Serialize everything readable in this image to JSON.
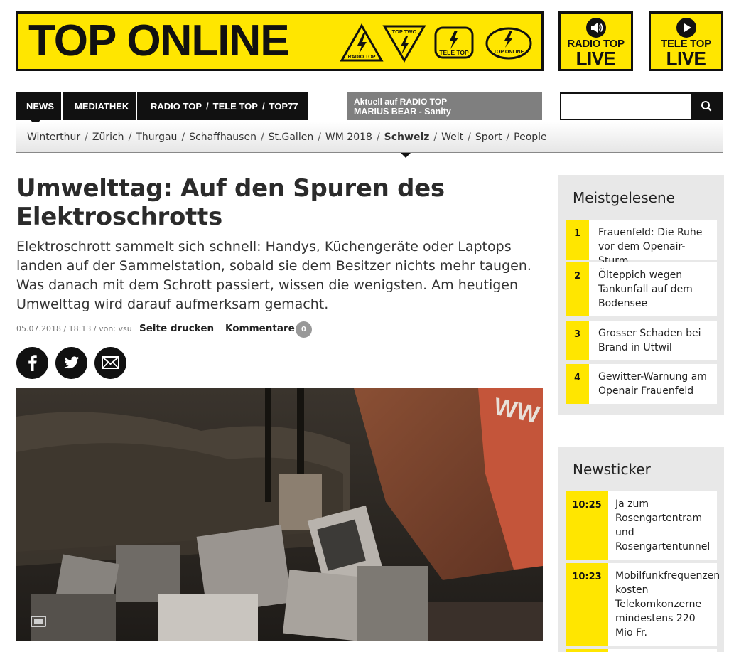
{
  "header": {
    "brand_title": "TOP ONLINE",
    "logos": [
      {
        "name": "radio-top-logo",
        "text": "RADIO TOP"
      },
      {
        "name": "top-two-logo",
        "text": "TOP TWO"
      },
      {
        "name": "tele-top-logo",
        "text": "TELE TOP"
      },
      {
        "name": "top-online-logo",
        "text": "TOP ONLINE"
      }
    ],
    "radio_live": {
      "line1": "RADIO TOP",
      "line2": "LIVE",
      "icon": "speaker-icon"
    },
    "tele_live": {
      "line1": "TELE TOP",
      "line2": "LIVE",
      "icon": "play-icon"
    }
  },
  "nav": {
    "news": "NEWS",
    "mediathek": "MEDIATHEK",
    "radio_top": "RADIO TOP",
    "tele_top": "TELE TOP",
    "top77": "TOP77",
    "separator": "/",
    "now_playing_title": "Aktuell auf RADIO TOP",
    "now_playing_track": "MARIUS BEAR - Sanity",
    "search_placeholder": "",
    "search_icon": "search-icon"
  },
  "subnav": {
    "items": [
      "Winterthur",
      "Zürich",
      "Thurgau",
      "Schaffhausen",
      "St.Gallen",
      "WM 2018",
      "Schweiz",
      "Welt",
      "Sport",
      "People"
    ],
    "active": "Schweiz"
  },
  "article": {
    "headline": "Umwelttag: Auf den Spuren des Elektroschrotts",
    "lead": "Elektroschrott sammelt sich schnell: Handys, Küchengeräte oder Laptops landen auf der Sammelstation, sobald sie dem Besitzer nichts mehr taugen. Was danach mit dem Schrott passiert, wissen die wenigsten. Am heutigen Umwelttag wird darauf aufmerksam gemacht.",
    "meta": "05.07.2018 / 18:13 / von: vsu",
    "print_label": "Seite drucken",
    "comments_label": "Kommentare",
    "comments_count": "0",
    "share_icons": [
      "facebook-icon",
      "twitter-icon",
      "email-icon"
    ]
  },
  "sidebar": {
    "most_read_title": "Meistgelesene",
    "most_read": [
      {
        "num": "1",
        "text": "Frauenfeld: Die Ruhe vor dem Openair-Sturm"
      },
      {
        "num": "2",
        "text": "Ölteppich wegen Tankunfall auf dem Bodensee"
      },
      {
        "num": "3",
        "text": "Grosser Schaden bei Brand in Uttwil"
      },
      {
        "num": "4",
        "text": "Gewitter-Warnung am Openair Frauenfeld"
      }
    ],
    "ticker_title": "Newsticker",
    "ticker": [
      {
        "time": "10:25",
        "text": "Ja zum Rosengartentram und Rosengartentunnel"
      },
      {
        "time": "10:23",
        "text": "Mobilfunkfrequenzen kosten Telekomkonzerne mindestens 220 Mio Fr."
      }
    ]
  },
  "colors": {
    "accent": "#ffe600",
    "dark": "#111111",
    "grey_box": "#7f7f7f"
  }
}
